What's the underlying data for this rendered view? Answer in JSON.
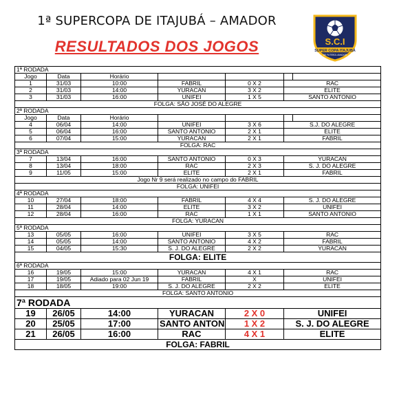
{
  "header": {
    "title": "1ª SUPERCOPA DE ITAJUBÁ – AMADOR",
    "subtitle": "RESULTADOS DOS JOGOS"
  },
  "logo": {
    "letters": "S.C.I",
    "ribbon": "SUPER COPA ITAJUBÁ",
    "small": "DE FUTEBOL AMADOR",
    "colors": {
      "navy": "#1d2a63",
      "gold": "#f4b81b"
    }
  },
  "columns": {
    "jogo": "Jogo",
    "data": "Data",
    "horario": "Horário"
  },
  "rounds": {
    "r1": {
      "title": "1ª RODADA",
      "games": [
        {
          "n": "1",
          "date": "31/03",
          "time": "10:00",
          "home": "FABRIL",
          "score": "0 X 2",
          "away": "RAC"
        },
        {
          "n": "2",
          "date": "31/03",
          "time": "14:00",
          "home": "YURACAN",
          "score": "3 X 2",
          "away": "ELITE"
        },
        {
          "n": "3",
          "date": "31/03",
          "time": "16:00",
          "home": "UNIFEI",
          "score": "1 X 5",
          "away": "SANTO ANTONIO"
        }
      ],
      "folga": "FOLGA: SÃO JOSÉ DO ALEGRE"
    },
    "r2": {
      "title": "2ª RODADA",
      "games": [
        {
          "n": "4",
          "date": "06/04",
          "time": "14:00",
          "home": "UNIFEI",
          "score": "3 X 6",
          "away": "S.J. DO ALEGRE"
        },
        {
          "n": "5",
          "date": "06/04",
          "time": "16:00",
          "home": "SANTO ANTONIO",
          "score": "2 X 1",
          "away": "ELITE"
        },
        {
          "n": "6",
          "date": "07/04",
          "time": "15:00",
          "home": "YURACAN",
          "score": "2 X 1",
          "away": "FABRIL"
        }
      ],
      "folga": "FOLGA: RAC"
    },
    "r3": {
      "title": "3ª RODADA",
      "games": [
        {
          "n": "7",
          "date": "13/04",
          "time": "16:00",
          "home": "SANTO ANTONIO",
          "score": "0 X 3",
          "away": "YURACAN"
        },
        {
          "n": "8",
          "date": "13/04",
          "time": "18:00",
          "home": "RAC",
          "score": "2 X 3",
          "away": "S. J. DO ALEGRE"
        },
        {
          "n": "9",
          "date": "11/05",
          "time": "15:00",
          "home": "ELITE",
          "score": "2 X 1",
          "away": "FABRIL"
        }
      ],
      "note": "Jogo Nr 9 será realizado no campo do FABRIL",
      "folga": "FOLGA: UNIFEI"
    },
    "r4": {
      "title": "4ª RODADA",
      "games": [
        {
          "n": "10",
          "date": "27/04",
          "time": "18:00",
          "home": "FABRIL",
          "score": "4 X 4",
          "away": "S. J. DO ALEGRE"
        },
        {
          "n": "11",
          "date": "28/04",
          "time": "14:00",
          "home": "ELITE",
          "score": "3 X 2",
          "away": "UNIFEI"
        },
        {
          "n": "12",
          "date": "28/04",
          "time": "16:00",
          "home": "RAC",
          "score": "1 X 1",
          "away": "SANTO ANTONIO"
        }
      ],
      "folga": "FOLGA: YURACAN"
    },
    "r5": {
      "title": "5ª RODADA",
      "games": [
        {
          "n": "13",
          "date": "05/05",
          "time": "16:00",
          "home": "UNIFEI",
          "score": "3 X 5",
          "away": "RAC"
        },
        {
          "n": "14",
          "date": "05/05",
          "time": "14:00",
          "home": "SANTO ANTONIO",
          "score": "4 X 2",
          "away": "FABRIL"
        },
        {
          "n": "15",
          "date": "04/05",
          "time": "15:30",
          "home": "S. J. DO ALEGRE",
          "score": "2 X 2",
          "away": "YURACAN"
        }
      ],
      "folga": "FOLGA: ELITE"
    },
    "r6": {
      "title": "6ª RODADA",
      "games": [
        {
          "n": "16",
          "date": "19/05",
          "time": "15:00",
          "home": "YURACAN",
          "score": "4 X 1",
          "away": "RAC"
        },
        {
          "n": "17",
          "date": "19/05",
          "time": "Adiado para 02 Jun 19",
          "home": "FABRIL",
          "score": "X",
          "away": "UNIFEI"
        },
        {
          "n": "18",
          "date": "18/05",
          "time": "19:00",
          "home": "S. J. DO ALEGRE",
          "score": "2 X 2",
          "away": "ELITE"
        }
      ],
      "folga": "FOLGA: SANTO ANTONIO"
    },
    "r7": {
      "title": "7ª RODADA",
      "games": [
        {
          "n": "19",
          "date": "26/05",
          "time": "14:00",
          "home": "YURACAN",
          "score": "2 X 0",
          "away": "UNIFEI"
        },
        {
          "n": "20",
          "date": "25/05",
          "time": "17:00",
          "home": "SANTO ANTONIO",
          "score": "1 X 2",
          "away": "S. J. DO ALEGRE"
        },
        {
          "n": "21",
          "date": "26/05",
          "time": "16:00",
          "home": "RAC",
          "score": "4 X 1",
          "away": "ELITE"
        }
      ],
      "folga": "FOLGA: FABRIL"
    }
  }
}
